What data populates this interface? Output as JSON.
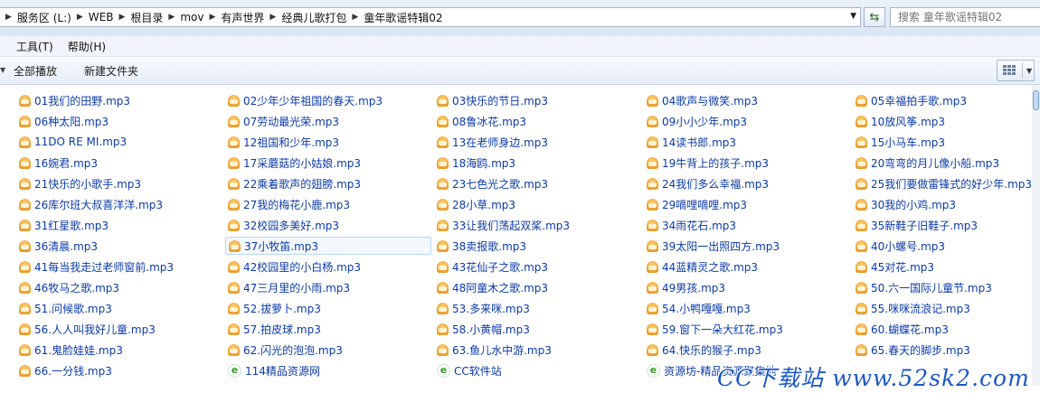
{
  "breadcrumb": [
    "服务区 (L:)",
    "WEB",
    "根目录",
    "mov",
    "有声世界",
    "经典儿歌打包",
    "童年歌谣特辑02"
  ],
  "search": {
    "placeholder": "搜索 童年歌谣特辑02"
  },
  "menu": [
    "工具(T)",
    "帮助(H)"
  ],
  "toolbar": {
    "play_all": "全部播放",
    "new_folder": "新建文件夹"
  },
  "columns": [
    [
      "01我们的田野.mp3",
      "06种太阳.mp3",
      "11DO RE MI.mp3",
      "16婉君.mp3",
      "21快乐的小歌手.mp3",
      "26库尔班大叔喜洋洋.mp3",
      "31红星歌.mp3",
      "36清晨.mp3",
      "41每当我走过老师窗前.mp3",
      "46牧马之歌.mp3",
      "51.问候歌.mp3",
      "56.人人叫我好儿童.mp3",
      "61.鬼脸娃娃.mp3",
      "66.一分钱.mp3"
    ],
    [
      "02少年少年祖国的春天.mp3",
      "07劳动最光荣.mp3",
      "12祖国和少年.mp3",
      "17采蘑菇的小姑娘.mp3",
      "22乘着歌声的翅膀.mp3",
      "27我的梅花小鹿.mp3",
      "32校园多美好.mp3",
      "37小牧笛.mp3",
      "42校园里的小白杨.mp3",
      "47三月里的小雨.mp3",
      "52.拔萝卜.mp3",
      "57.拍皮球.mp3",
      "62.闪光的泡泡.mp3",
      "114精品资源网"
    ],
    [
      "03快乐的节日.mp3",
      "08鲁冰花.mp3",
      "13在老师身边.mp3",
      "18海鸥.mp3",
      "23七色光之歌.mp3",
      "28小草.mp3",
      "33让我们荡起双桨.mp3",
      "38卖报歌.mp3",
      "43花仙子之歌.mp3",
      "48阿童木之歌.mp3",
      "53.多来咪.mp3",
      "58.小黄帽.mp3",
      "63.鱼儿水中游.mp3",
      "CC软件站"
    ],
    [
      "04歌声与微笑.mp3",
      "09小小少年.mp3",
      "14读书郎.mp3",
      "19牛背上的孩子.mp3",
      "24我们多么幸福.mp3",
      "29嘀哩嘀哩.mp3",
      "34雨花石.mp3",
      "39太阳一出照四方.mp3",
      "44蓝精灵之歌.mp3",
      "49男孩.mp3",
      "54.小鸭嘎嘎.mp3",
      "59.窗下一朵大红花.mp3",
      "64.快乐的猴子.mp3",
      "资源坊-精品资源聚集地"
    ],
    [
      "05幸福拍手歌.mp3",
      "10放风筝.mp3",
      "15小马车.mp3",
      "20弯弯的月儿像小船.mp3",
      "25我们要做雷锋式的好少年.mp3",
      "30我的小鸡.mp3",
      "35新鞋子旧鞋子.mp3",
      "40小螺号.mp3",
      "45对花.mp3",
      "50.六一国际儿童节.mp3",
      "55.咪咪流浪记.mp3",
      "60.蝴蝶花.mp3",
      "65.春天的脚步.mp3"
    ]
  ],
  "icons": {
    "audio": "audio-file-icon",
    "link": "web-shortcut-icon",
    "audio_color": "#f0a020",
    "link_color": "#3a9a2a"
  },
  "selected": "37小牧笛.mp3",
  "watermark": "CC下载站 www.52sk2.com"
}
